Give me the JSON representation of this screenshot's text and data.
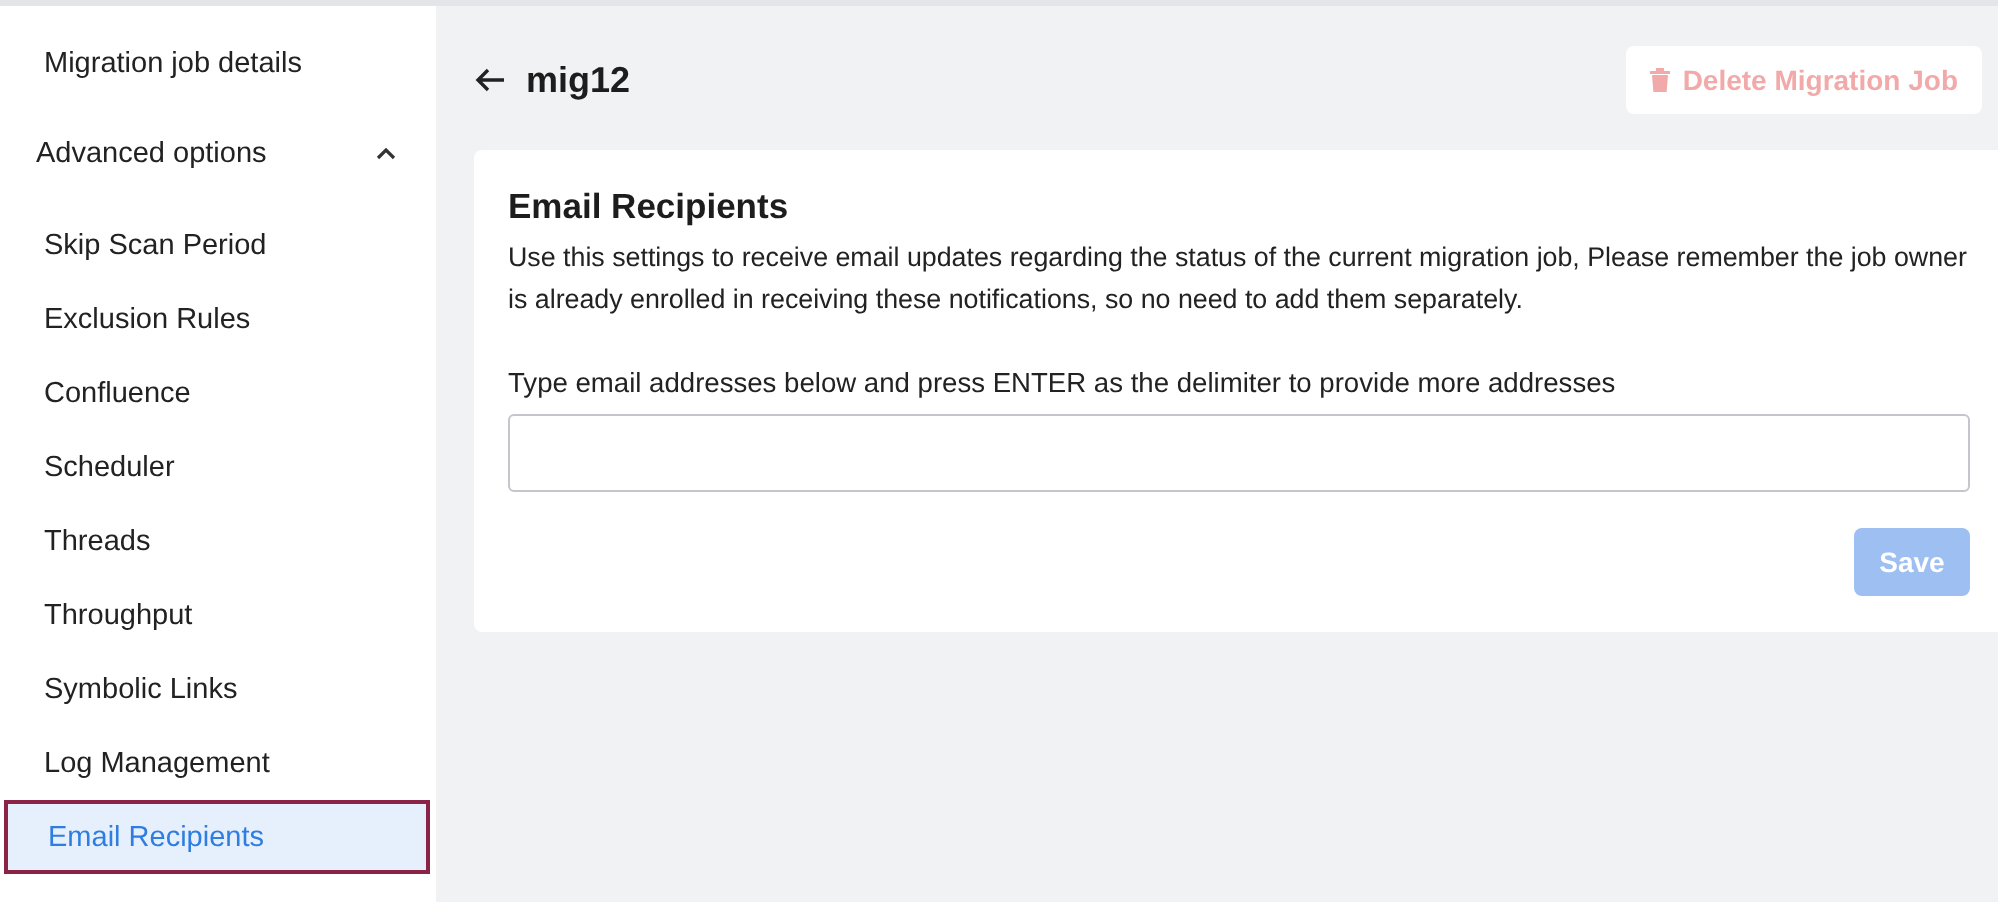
{
  "sidebar": {
    "items": [
      {
        "label": "Migration job details",
        "selected": false
      }
    ],
    "section": {
      "label": "Advanced options",
      "expanded": true,
      "items": [
        {
          "label": "Skip Scan Period",
          "selected": false
        },
        {
          "label": "Exclusion Rules",
          "selected": false
        },
        {
          "label": "Confluence",
          "selected": false
        },
        {
          "label": "Scheduler",
          "selected": false
        },
        {
          "label": "Threads",
          "selected": false
        },
        {
          "label": "Throughput",
          "selected": false
        },
        {
          "label": "Symbolic Links",
          "selected": false
        },
        {
          "label": "Log Management",
          "selected": false
        },
        {
          "label": "Email Recipients",
          "selected": true
        }
      ]
    }
  },
  "header": {
    "title": "mig12",
    "delete_button": {
      "label": "Delete Migration Job",
      "disabled": true
    }
  },
  "card": {
    "title": "Email Recipients",
    "description": "Use this settings to receive email updates regarding the status of the current migration job, Please remember the job owner is already enrolled in receiving these notifications, so no need to add them separately.",
    "field_label": "Type email addresses below and press ENTER as the delimiter to provide more addresses",
    "save_button": {
      "label": "Save",
      "disabled": true
    }
  }
}
